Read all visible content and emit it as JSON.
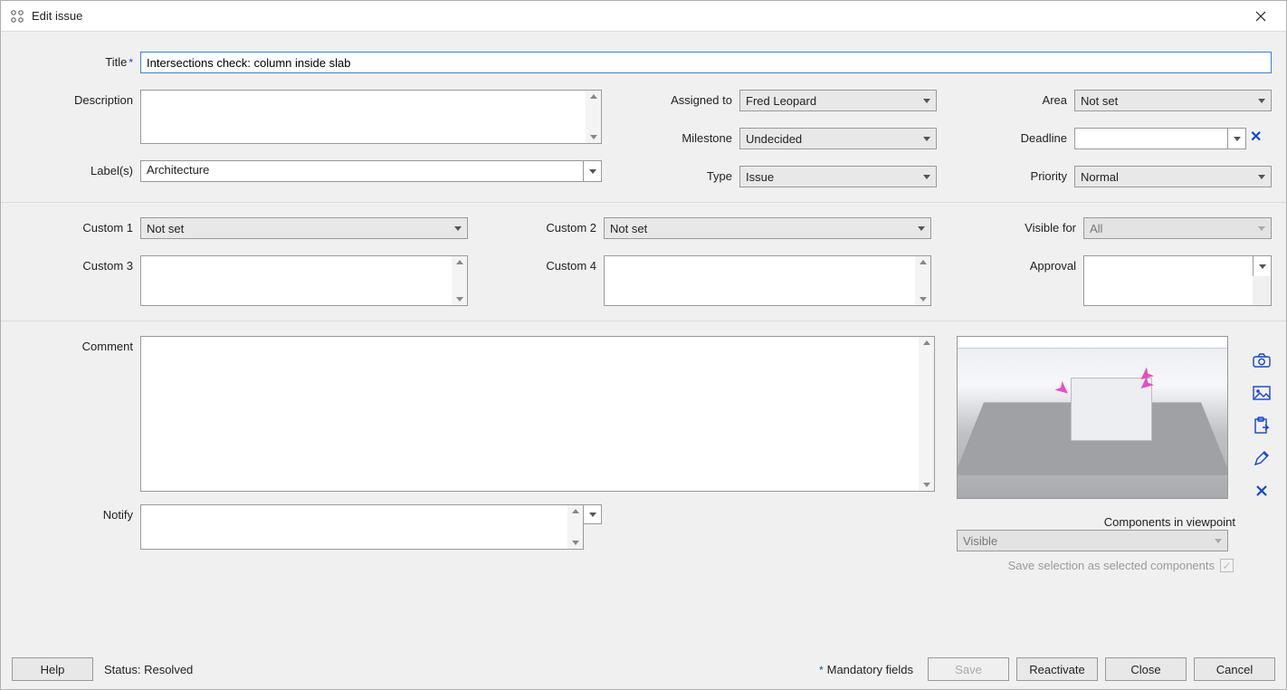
{
  "window": {
    "title": "Edit issue"
  },
  "fields": {
    "title_label": "Title",
    "title_value": "Intersections check: column inside slab",
    "description_label": "Description",
    "description_value": "",
    "labels_label": "Label(s)",
    "labels_value": "Architecture",
    "assigned_label": "Assigned to",
    "assigned_value": "Fred Leopard",
    "milestone_label": "Milestone",
    "milestone_value": "Undecided",
    "type_label": "Type",
    "type_value": "Issue",
    "area_label": "Area",
    "area_value": "Not set",
    "deadline_label": "Deadline",
    "deadline_value": "",
    "priority_label": "Priority",
    "priority_value": "Normal",
    "custom1_label": "Custom 1",
    "custom1_value": "Not set",
    "custom2_label": "Custom 2",
    "custom2_value": "Not set",
    "custom3_label": "Custom 3",
    "custom3_value": "",
    "custom4_label": "Custom 4",
    "custom4_value": "",
    "visible_label": "Visible for",
    "visible_value": "All",
    "approval_label": "Approval",
    "approval_value": "",
    "comment_label": "Comment",
    "comment_value": "",
    "notify_label": "Notify",
    "notify_value": "",
    "components_label": "Components in viewpoint",
    "components_value": "Visible",
    "save_selection_label": "Save selection as selected components"
  },
  "footer": {
    "help": "Help",
    "status_prefix": "Status: ",
    "status_value": "Resolved",
    "mandatory": "Mandatory fields",
    "save": "Save",
    "reactivate": "Reactivate",
    "close": "Close",
    "cancel": "Cancel"
  }
}
